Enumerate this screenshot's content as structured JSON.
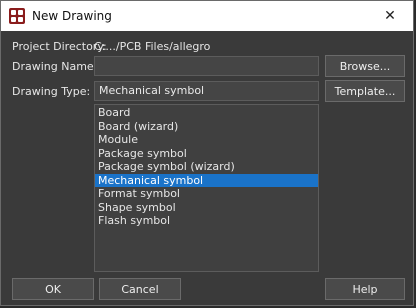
{
  "window": {
    "title": "New Drawing",
    "close_glyph": "✕"
  },
  "form": {
    "project_directory_label": "Project Directory:",
    "project_directory_value": "C:.../PCB Files/allegro",
    "drawing_name_label": "Drawing Name:",
    "drawing_name_value": "",
    "drawing_type_label": "Drawing Type:",
    "drawing_type_value": "Mechanical symbol"
  },
  "buttons": {
    "browse": "Browse...",
    "template": "Template...",
    "ok": "OK",
    "cancel": "Cancel",
    "help": "Help"
  },
  "drawing_types": [
    "Board",
    "Board (wizard)",
    "Module",
    "Package symbol",
    "Package symbol (wizard)",
    "Mechanical symbol",
    "Format symbol",
    "Shape symbol",
    "Flash symbol"
  ],
  "selected_type": "Mechanical symbol",
  "colors": {
    "selection": "#1a73c9",
    "window_bg": "#3a3a3a"
  }
}
